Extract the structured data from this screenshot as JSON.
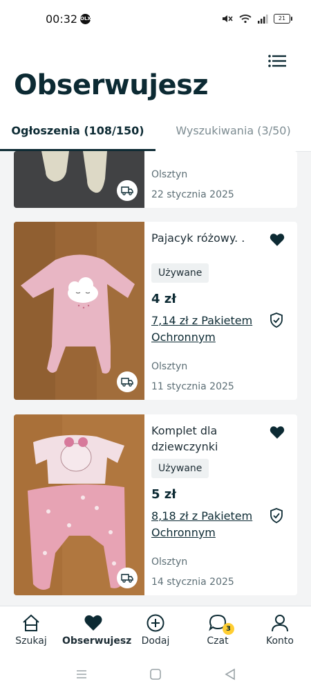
{
  "status_bar": {
    "time": "00:32",
    "app_badge": "OLX",
    "battery": "21"
  },
  "header": {
    "title": "Obserwujesz",
    "menu_icon": "list-icon"
  },
  "tabs": [
    {
      "label": "Ogłoszenia (108/150)",
      "active": true
    },
    {
      "label": "Wyszukiwania (3/50)",
      "active": false
    }
  ],
  "listings": [
    {
      "location": "Olsztyn",
      "date": "22 stycznia 2025"
    },
    {
      "title": "Pajacyk różowy.  .",
      "condition": "Używane",
      "price": "4 zł",
      "protected_price": "7,14 zł z Pakietem Ochronnym",
      "location": "Olsztyn",
      "date": "11 stycznia 2025"
    },
    {
      "title": "Komplet dla dziewczynki",
      "condition": "Używane",
      "price": "5 zł",
      "protected_price": "8,18 zł z Pakietem Ochronnym",
      "location": "Olsztyn",
      "date": "14 stycznia 2025"
    }
  ],
  "bottom_nav": [
    {
      "label": "Szukaj",
      "icon": "home-icon"
    },
    {
      "label": "Obserwujesz",
      "icon": "heart-icon",
      "active": true
    },
    {
      "label": "Dodaj",
      "icon": "plus-circle-icon"
    },
    {
      "label": "Czat",
      "icon": "chat-icon",
      "badge": "3"
    },
    {
      "label": "Konto",
      "icon": "user-icon"
    }
  ],
  "colors": {
    "brand_dark": "#0c2a33",
    "badge_yellow": "#ffce32",
    "background": "#f3f4f5"
  }
}
